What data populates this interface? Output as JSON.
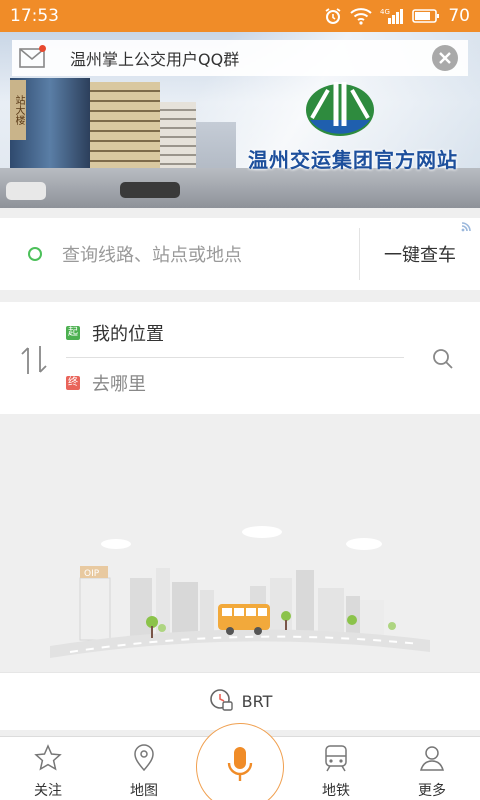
{
  "status_bar": {
    "time": "17:53",
    "battery": "70",
    "network": "4G",
    "bg_color": "#f08c28"
  },
  "banner": {
    "site_name": "温州交运集团官方网站",
    "building_sign": "站大楼",
    "notice_text": "温州掌上公交用户QQ群"
  },
  "search": {
    "placeholder": "查询线路、站点或地点",
    "one_key_label": "一键查车"
  },
  "route": {
    "start_tag": "起",
    "end_tag": "终",
    "from_text": "我的位置",
    "to_text": "去哪里"
  },
  "illustration": {
    "sign": "OIP"
  },
  "brt": {
    "label": "BRT"
  },
  "tabs": [
    {
      "label": "关注",
      "icon": "star-icon"
    },
    {
      "label": "地图",
      "icon": "map-pin-icon"
    },
    {
      "label": "",
      "icon": "microphone-icon"
    },
    {
      "label": "地铁",
      "icon": "subway-icon"
    },
    {
      "label": "更多",
      "icon": "person-icon"
    }
  ],
  "colors": {
    "accent": "#f08c28",
    "start_green": "#4cb050",
    "end_red": "#e9645a"
  }
}
